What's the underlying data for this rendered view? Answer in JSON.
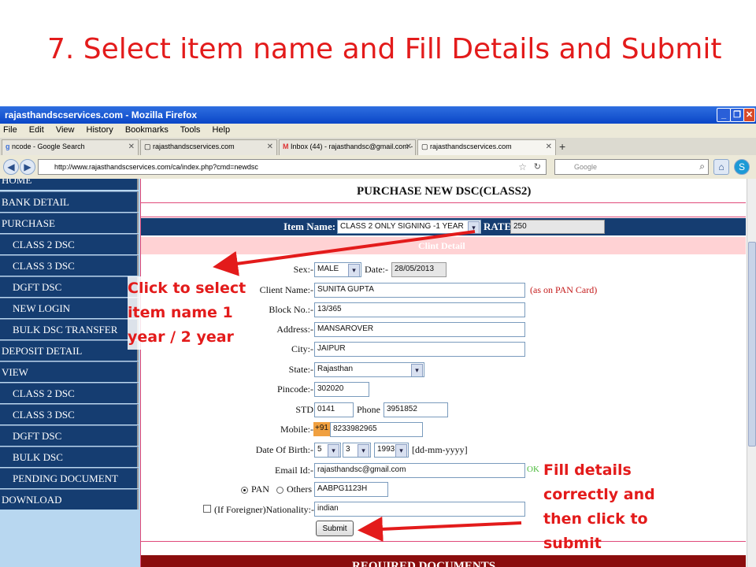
{
  "slide": {
    "title": "7. Select item name and Fill Details and Submit",
    "callout_left": "Click to select item name 1 year / 2 year",
    "callout_left_lines": [
      "Click to select",
      "item name 1",
      "year / 2 year"
    ],
    "callout_right_lines": [
      "Fill details",
      "correctly  and",
      "then click to",
      "submit"
    ],
    "arrow_color": "#e31b1b"
  },
  "browser": {
    "window_title": "rajasthandscservices.com - Mozilla Firefox",
    "menu": [
      "File",
      "Edit",
      "View",
      "History",
      "Bookmarks",
      "Tools",
      "Help"
    ],
    "tabs": [
      {
        "label": "ncode - Google Search",
        "icon": "google-icon"
      },
      {
        "label": "rajasthandscservices.com",
        "icon": "page-icon"
      },
      {
        "label": "Inbox (44) - rajasthandsc@gmail.com - G...",
        "icon": "gmail-icon"
      },
      {
        "label": "rajasthandscservices.com",
        "icon": "page-icon",
        "active": true
      }
    ],
    "url": "http://www.rajasthandscservices.com/ca/index.php?cmd=newdsc",
    "search_placeholder": "Google"
  },
  "sidebar": {
    "items": [
      {
        "label": "HOME",
        "type": "main"
      },
      {
        "label": "BANK DETAIL",
        "type": "main"
      },
      {
        "label": "PURCHASE",
        "type": "main"
      },
      {
        "label": "CLASS 2 DSC",
        "type": "sub"
      },
      {
        "label": "CLASS 3 DSC",
        "type": "sub"
      },
      {
        "label": "DGFT DSC",
        "type": "sub"
      },
      {
        "label": "NEW LOGIN",
        "type": "sub"
      },
      {
        "label": "BULK DSC TRANSFER",
        "type": "sub"
      },
      {
        "label": "DEPOSIT DETAIL",
        "type": "main"
      },
      {
        "label": "VIEW",
        "type": "main"
      },
      {
        "label": "CLASS 2 DSC",
        "type": "sub"
      },
      {
        "label": "CLASS 3 DSC",
        "type": "sub"
      },
      {
        "label": "DGFT DSC",
        "type": "sub"
      },
      {
        "label": "BULK DSC",
        "type": "sub"
      },
      {
        "label": "PENDING DOCUMENT",
        "type": "sub"
      },
      {
        "label": "DOWNLOAD",
        "type": "main"
      }
    ]
  },
  "form": {
    "title": "PURCHASE NEW DSC(CLASS2)",
    "item_name_label": "Item Name:",
    "item_name_value": "CLASS 2 ONLY SIGNING -1 YEAR",
    "rate_label": "RATE:",
    "rate_value": "250",
    "section_title": "Clint Detail",
    "sex_label": "Sex:-",
    "sex_value": "MALE",
    "date_label": "Date:-",
    "date_value": "28/05/2013",
    "client_name_label": "Client Name:-",
    "client_name_value": "SUNITA GUPTA",
    "pan_note": "(as on PAN Card)",
    "block_label": "Block No.:-",
    "block_value": "13/365",
    "address_label": "Address:-",
    "address_value": "MANSAROVER",
    "city_label": "City:-",
    "city_value": "JAIPUR",
    "state_label": "State:-",
    "state_value": "Rajasthan",
    "pincode_label": "Pincode:-",
    "pincode_value": "302020",
    "std_label": "STD",
    "std_value": "0141",
    "phone_label": "Phone",
    "phone_value": "3951852",
    "mobile_label": "Mobile:-",
    "mobile_prefix": "+91",
    "mobile_value": "8233982965",
    "dob_label": "Date Of Birth:-",
    "dob_day": "5",
    "dob_month": "3",
    "dob_year": "1993",
    "dob_format": "[dd-mm-yyyy]",
    "email_label": "Email Id:-",
    "email_value": "rajasthandsc@gmail.com",
    "email_status": "OK",
    "pan_radio_label": "PAN",
    "others_radio_label": "Others",
    "pan_number": "AABPG1123H",
    "foreigner_label": "(If Foreigner)Nationality:-",
    "nationality_value": "indian",
    "submit_label": "Submit",
    "required_documents": "REQUIRED DOCUMENTS"
  }
}
